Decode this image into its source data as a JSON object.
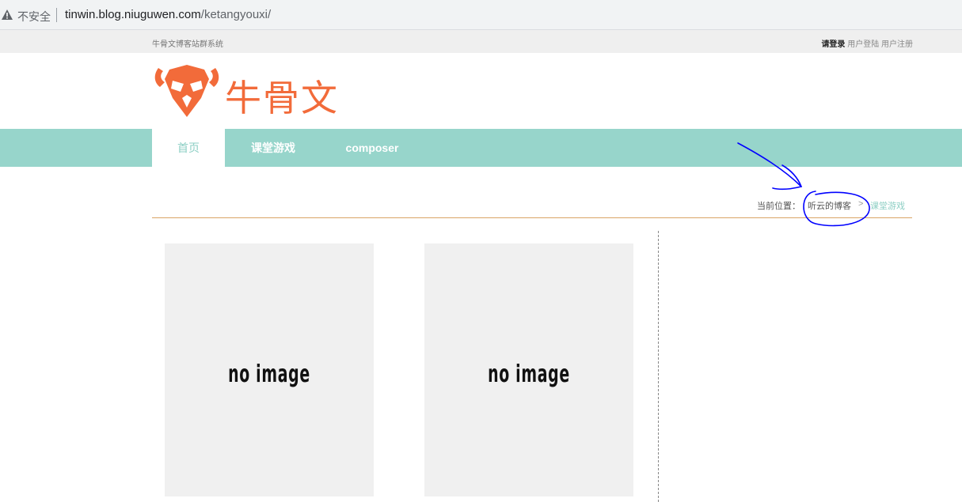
{
  "browser": {
    "security_label": "不安全",
    "url_host": "tinwin.blog.niuguwen.com",
    "url_path": "/ketangyouxi/"
  },
  "topbar": {
    "site_name": "牛骨文博客站群系统",
    "login_prompt": "请登录",
    "user_login": "用户登陆",
    "user_register": "用户注册"
  },
  "logo": {
    "text": "牛骨文",
    "color": "#f26b3a"
  },
  "nav": {
    "items": [
      {
        "label": "首页",
        "active": true
      },
      {
        "label": "课堂游戏",
        "active": false
      },
      {
        "label": "composer",
        "active": false
      }
    ],
    "bg_color": "#97d5cb"
  },
  "breadcrumb": {
    "prefix": "当前位置：",
    "home": "听云的博客",
    "separator": ">",
    "current": "课堂游戏"
  },
  "posts": [
    {
      "placeholder": "no image"
    },
    {
      "placeholder": "no image"
    }
  ],
  "annotation_color": "#0000ff"
}
